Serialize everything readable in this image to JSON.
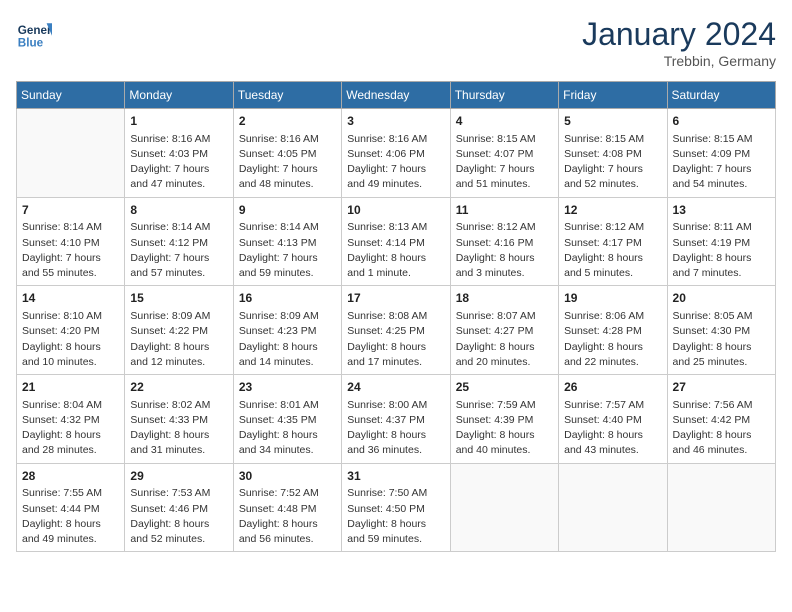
{
  "logo": {
    "line1": "General",
    "line2": "Blue"
  },
  "title": "January 2024",
  "location": "Trebbin, Germany",
  "days_header": [
    "Sunday",
    "Monday",
    "Tuesday",
    "Wednesday",
    "Thursday",
    "Friday",
    "Saturday"
  ],
  "weeks": [
    [
      {
        "num": "",
        "info": ""
      },
      {
        "num": "1",
        "info": "Sunrise: 8:16 AM\nSunset: 4:03 PM\nDaylight: 7 hours\nand 47 minutes."
      },
      {
        "num": "2",
        "info": "Sunrise: 8:16 AM\nSunset: 4:05 PM\nDaylight: 7 hours\nand 48 minutes."
      },
      {
        "num": "3",
        "info": "Sunrise: 8:16 AM\nSunset: 4:06 PM\nDaylight: 7 hours\nand 49 minutes."
      },
      {
        "num": "4",
        "info": "Sunrise: 8:15 AM\nSunset: 4:07 PM\nDaylight: 7 hours\nand 51 minutes."
      },
      {
        "num": "5",
        "info": "Sunrise: 8:15 AM\nSunset: 4:08 PM\nDaylight: 7 hours\nand 52 minutes."
      },
      {
        "num": "6",
        "info": "Sunrise: 8:15 AM\nSunset: 4:09 PM\nDaylight: 7 hours\nand 54 minutes."
      }
    ],
    [
      {
        "num": "7",
        "info": "Sunrise: 8:14 AM\nSunset: 4:10 PM\nDaylight: 7 hours\nand 55 minutes."
      },
      {
        "num": "8",
        "info": "Sunrise: 8:14 AM\nSunset: 4:12 PM\nDaylight: 7 hours\nand 57 minutes."
      },
      {
        "num": "9",
        "info": "Sunrise: 8:14 AM\nSunset: 4:13 PM\nDaylight: 7 hours\nand 59 minutes."
      },
      {
        "num": "10",
        "info": "Sunrise: 8:13 AM\nSunset: 4:14 PM\nDaylight: 8 hours\nand 1 minute."
      },
      {
        "num": "11",
        "info": "Sunrise: 8:12 AM\nSunset: 4:16 PM\nDaylight: 8 hours\nand 3 minutes."
      },
      {
        "num": "12",
        "info": "Sunrise: 8:12 AM\nSunset: 4:17 PM\nDaylight: 8 hours\nand 5 minutes."
      },
      {
        "num": "13",
        "info": "Sunrise: 8:11 AM\nSunset: 4:19 PM\nDaylight: 8 hours\nand 7 minutes."
      }
    ],
    [
      {
        "num": "14",
        "info": "Sunrise: 8:10 AM\nSunset: 4:20 PM\nDaylight: 8 hours\nand 10 minutes."
      },
      {
        "num": "15",
        "info": "Sunrise: 8:09 AM\nSunset: 4:22 PM\nDaylight: 8 hours\nand 12 minutes."
      },
      {
        "num": "16",
        "info": "Sunrise: 8:09 AM\nSunset: 4:23 PM\nDaylight: 8 hours\nand 14 minutes."
      },
      {
        "num": "17",
        "info": "Sunrise: 8:08 AM\nSunset: 4:25 PM\nDaylight: 8 hours\nand 17 minutes."
      },
      {
        "num": "18",
        "info": "Sunrise: 8:07 AM\nSunset: 4:27 PM\nDaylight: 8 hours\nand 20 minutes."
      },
      {
        "num": "19",
        "info": "Sunrise: 8:06 AM\nSunset: 4:28 PM\nDaylight: 8 hours\nand 22 minutes."
      },
      {
        "num": "20",
        "info": "Sunrise: 8:05 AM\nSunset: 4:30 PM\nDaylight: 8 hours\nand 25 minutes."
      }
    ],
    [
      {
        "num": "21",
        "info": "Sunrise: 8:04 AM\nSunset: 4:32 PM\nDaylight: 8 hours\nand 28 minutes."
      },
      {
        "num": "22",
        "info": "Sunrise: 8:02 AM\nSunset: 4:33 PM\nDaylight: 8 hours\nand 31 minutes."
      },
      {
        "num": "23",
        "info": "Sunrise: 8:01 AM\nSunset: 4:35 PM\nDaylight: 8 hours\nand 34 minutes."
      },
      {
        "num": "24",
        "info": "Sunrise: 8:00 AM\nSunset: 4:37 PM\nDaylight: 8 hours\nand 36 minutes."
      },
      {
        "num": "25",
        "info": "Sunrise: 7:59 AM\nSunset: 4:39 PM\nDaylight: 8 hours\nand 40 minutes."
      },
      {
        "num": "26",
        "info": "Sunrise: 7:57 AM\nSunset: 4:40 PM\nDaylight: 8 hours\nand 43 minutes."
      },
      {
        "num": "27",
        "info": "Sunrise: 7:56 AM\nSunset: 4:42 PM\nDaylight: 8 hours\nand 46 minutes."
      }
    ],
    [
      {
        "num": "28",
        "info": "Sunrise: 7:55 AM\nSunset: 4:44 PM\nDaylight: 8 hours\nand 49 minutes."
      },
      {
        "num": "29",
        "info": "Sunrise: 7:53 AM\nSunset: 4:46 PM\nDaylight: 8 hours\nand 52 minutes."
      },
      {
        "num": "30",
        "info": "Sunrise: 7:52 AM\nSunset: 4:48 PM\nDaylight: 8 hours\nand 56 minutes."
      },
      {
        "num": "31",
        "info": "Sunrise: 7:50 AM\nSunset: 4:50 PM\nDaylight: 8 hours\nand 59 minutes."
      },
      {
        "num": "",
        "info": ""
      },
      {
        "num": "",
        "info": ""
      },
      {
        "num": "",
        "info": ""
      }
    ]
  ]
}
